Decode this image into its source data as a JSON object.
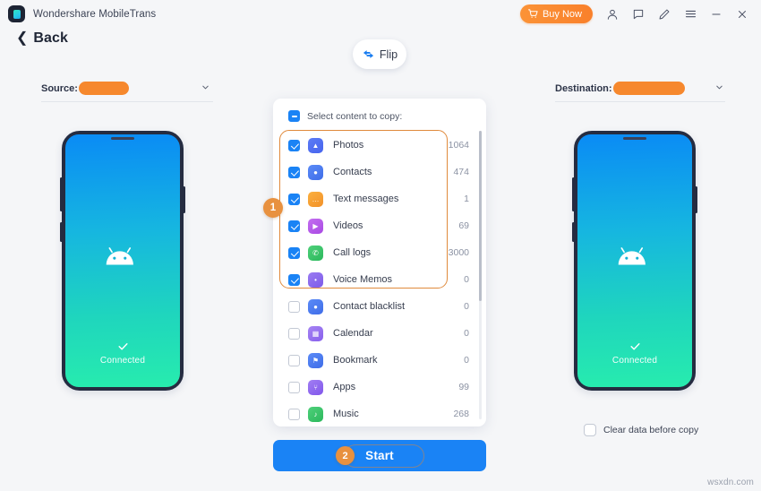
{
  "window": {
    "app_title": "Wondershare MobileTrans",
    "logo_icon": "mobiletrans-logo-icon",
    "buy_label": "Buy Now",
    "cart_icon": "shopping-cart-icon",
    "account_icon": "account-person-icon",
    "feedback_icon": "chat-bubble-icon",
    "edit_icon": "pen-edit-icon",
    "menu_icon": "hamburger-menu-icon",
    "minimize_icon": "minimize-icon",
    "close_icon": "close-icon"
  },
  "nav": {
    "back_label": "Back",
    "back_icon": "chevron-left-icon"
  },
  "flip": {
    "label": "Flip",
    "icon": "flip-arrows-icon"
  },
  "source": {
    "label": "Source:",
    "device_name": "",
    "caret_icon": "chevron-down-icon",
    "status": "Connected",
    "status_icon": "check-icon",
    "platform_icon": "android-robot-icon"
  },
  "destination": {
    "label": "Destination:",
    "device_name": "",
    "caret_icon": "chevron-down-icon",
    "status": "Connected",
    "status_icon": "check-icon",
    "platform_icon": "android-robot-icon"
  },
  "panel": {
    "header_label": "Select content to copy:",
    "header_checkbox_state": "indeterminate",
    "items": [
      {
        "label": "Photos",
        "count": "1064",
        "checked": true,
        "icon": "photos-icon",
        "icon_class": "ic-photos",
        "glyph": "▲"
      },
      {
        "label": "Contacts",
        "count": "474",
        "checked": true,
        "icon": "contacts-icon",
        "icon_class": "ic-contacts",
        "glyph": "●"
      },
      {
        "label": "Text messages",
        "count": "1",
        "checked": true,
        "icon": "sms-icon",
        "icon_class": "ic-sms",
        "glyph": "…"
      },
      {
        "label": "Videos",
        "count": "69",
        "checked": true,
        "icon": "videos-icon",
        "icon_class": "ic-videos",
        "glyph": "▶"
      },
      {
        "label": "Call logs",
        "count": "3000",
        "checked": true,
        "icon": "calllogs-icon",
        "icon_class": "ic-calllogs",
        "glyph": "✆"
      },
      {
        "label": "Voice Memos",
        "count": "0",
        "checked": true,
        "icon": "voicememo-icon",
        "icon_class": "ic-voice",
        "glyph": "•"
      },
      {
        "label": "Contact blacklist",
        "count": "0",
        "checked": false,
        "icon": "blacklist-icon",
        "icon_class": "ic-blacklist",
        "glyph": "●"
      },
      {
        "label": "Calendar",
        "count": "0",
        "checked": false,
        "icon": "calendar-icon",
        "icon_class": "ic-calendar",
        "glyph": "▦"
      },
      {
        "label": "Bookmark",
        "count": "0",
        "checked": false,
        "icon": "bookmark-icon",
        "icon_class": "ic-bookmark",
        "glyph": "⚑"
      },
      {
        "label": "Apps",
        "count": "99",
        "checked": false,
        "icon": "apps-icon",
        "icon_class": "ic-apps",
        "glyph": "⑂"
      },
      {
        "label": "Music",
        "count": "268",
        "checked": false,
        "icon": "music-icon",
        "icon_class": "ic-music",
        "glyph": "♪"
      }
    ]
  },
  "annotations": {
    "step_one": "1",
    "step_two": "2"
  },
  "start": {
    "label": "Start"
  },
  "clear_data": {
    "label": "Clear data before copy",
    "checked": false
  },
  "watermark": {
    "text": "wsxdn.com"
  },
  "colors": {
    "accent_orange": "#f6882d",
    "primary_blue": "#1a83f5",
    "annotation": "#e08a3c",
    "background": "#f5f6f8"
  }
}
